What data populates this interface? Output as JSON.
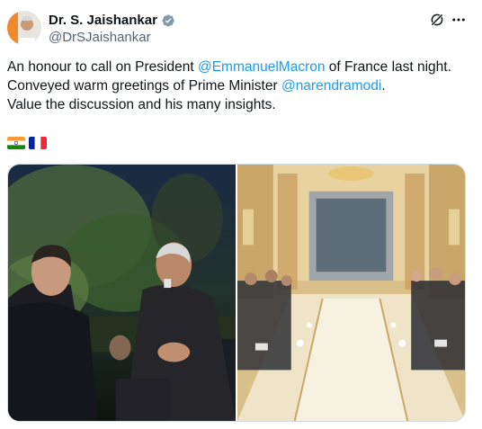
{
  "author": {
    "display_name": "Dr. S. Jaishankar",
    "handle": "@DrSJaishankar",
    "verified": true,
    "avatar_icon": "profile-photo"
  },
  "header_icons": {
    "grok": "grok-icon",
    "more": "more-icon"
  },
  "tweet": {
    "line1_pre": "An honour to call on President ",
    "line1_mention": "@EmmanuelMacron",
    "line1_post": " of France last night.",
    "line2_pre": "Conveyed warm greetings of Prime Minister ",
    "line2_mention": "@narendramodi",
    "line2_post": ".",
    "line3": "Value the discussion and his many insights."
  },
  "flags": [
    "india-flag",
    "france-flag"
  ],
  "media": {
    "photo1": "handshake-garden-photo",
    "photo2": "delegation-meeting-photo"
  },
  "colors": {
    "link": "#1d9bf0",
    "verified": "#829aab",
    "secondary_text": "#536471"
  }
}
